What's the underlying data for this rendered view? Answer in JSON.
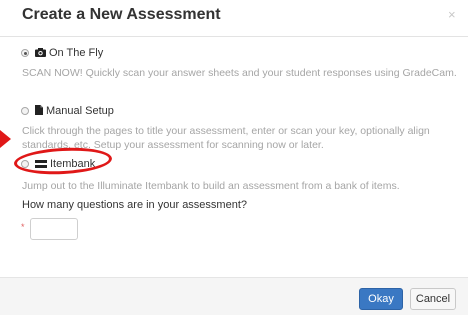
{
  "dialog": {
    "title": "Create a New Assessment",
    "close_glyph": "×"
  },
  "options": [
    {
      "label": "On The Fly",
      "icon": "camera-icon",
      "selected": true,
      "description": "SCAN NOW! Quickly scan your answer sheets and your student responses using GradeCam."
    },
    {
      "label": "Manual Setup",
      "icon": "document-icon",
      "selected": false,
      "description": "Click through the pages to title your assessment, enter or scan your key, optionally align standards, etc. Setup your assessment for scanning now or later."
    },
    {
      "label": "Itembank",
      "icon": "itembank-icon",
      "selected": false,
      "description": "Jump out to the Illuminate Itembank to build an assessment from a bank of items."
    }
  ],
  "question": {
    "label": "How many questions are in your assessment?",
    "required_marker": "*",
    "value": ""
  },
  "buttons": {
    "ok_label": "Okay",
    "cancel_label": "Cancel"
  },
  "colors": {
    "primary": "#3a78c3",
    "annotation": "#e01818"
  }
}
